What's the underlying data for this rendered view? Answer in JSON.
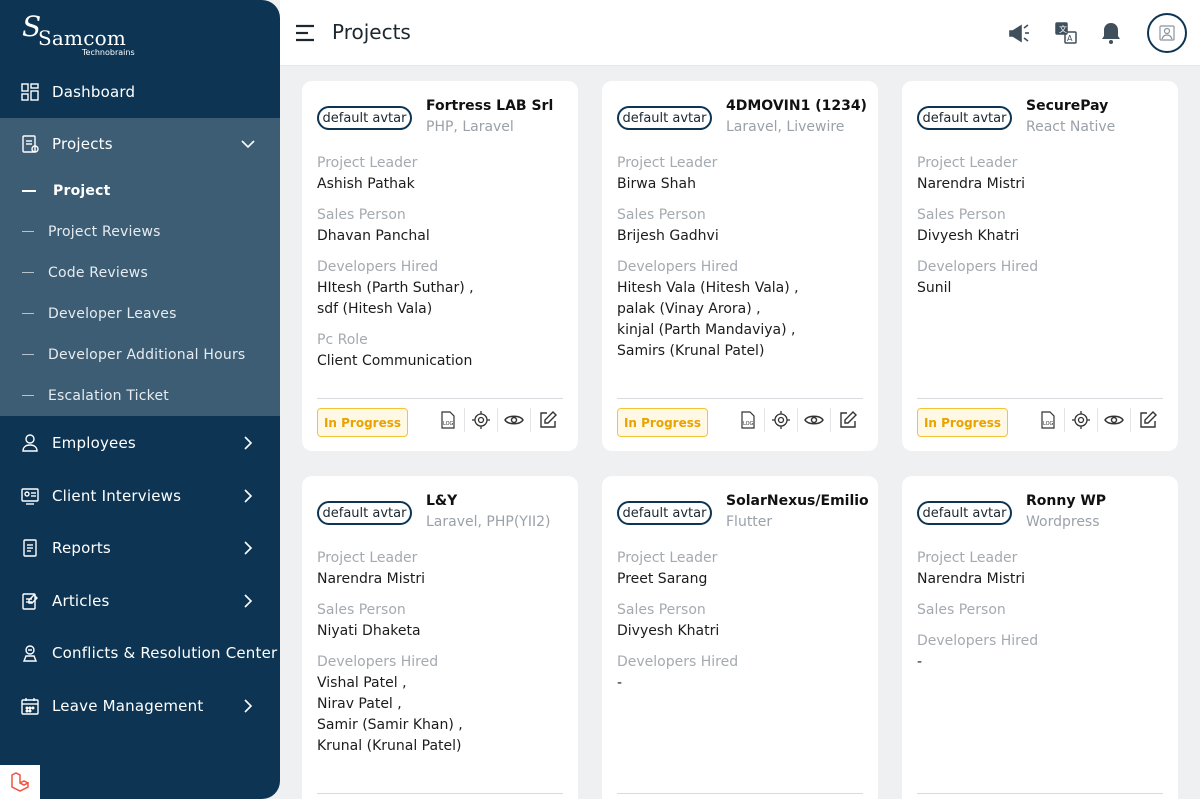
{
  "brand": {
    "name": "Samcom",
    "sub": "Technobrains",
    "mark": "S"
  },
  "header": {
    "title": "Projects"
  },
  "sidebar": {
    "items": [
      {
        "label": "Dashboard",
        "icon": "dashboard-icon"
      },
      {
        "label": "Projects",
        "icon": "projects-icon"
      },
      {
        "label": "Employees",
        "icon": "employees-icon"
      },
      {
        "label": "Client Interviews",
        "icon": "client-interviews-icon"
      },
      {
        "label": "Reports",
        "icon": "reports-icon"
      },
      {
        "label": "Articles",
        "icon": "articles-icon"
      },
      {
        "label": "Conflicts & Resolution Center",
        "icon": "conflicts-icon"
      },
      {
        "label": "Leave Management",
        "icon": "leave-icon"
      }
    ],
    "project_sub": [
      {
        "label": "Project"
      },
      {
        "label": "Project Reviews"
      },
      {
        "label": "Code Reviews"
      },
      {
        "label": "Developer Leaves"
      },
      {
        "label": "Developer Additional Hours"
      },
      {
        "label": "Escalation Ticket"
      }
    ]
  },
  "labels": {
    "leader": "Project Leader",
    "sales": "Sales Person",
    "devs": "Developers Hired",
    "pc_role": "Pc Role",
    "avatar_alt": "default avtar"
  },
  "cards": [
    {
      "name": "Fortress LAB Srl",
      "tech": "PHP, Laravel",
      "leader": "Ashish Pathak",
      "sales": "Dhavan Panchal",
      "devs": [
        "HItesh (Parth Suthar) ,",
        "sdf (Hitesh Vala)"
      ],
      "pc_role": "Client Communication",
      "status": "In Progress"
    },
    {
      "name": "4DMOVIN1 (1234)",
      "tech": "Laravel, Livewire",
      "leader": "Birwa Shah",
      "sales": "Brijesh Gadhvi",
      "devs": [
        "Hitesh Vala (Hitesh Vala) ,",
        "palak (Vinay Arora) ,",
        "kinjal (Parth Mandaviya) ,",
        "Samirs (Krunal Patel)"
      ],
      "status": "In Progress"
    },
    {
      "name": "SecurePay",
      "tech": "React Native",
      "leader": "Narendra Mistri",
      "sales": "Divyesh Khatri",
      "devs": [
        "Sunil"
      ],
      "status": "In Progress"
    },
    {
      "name": "L&Y",
      "tech": "Laravel, PHP(YII2)",
      "leader": "Narendra Mistri",
      "sales": "Niyati Dhaketa",
      "devs": [
        "Vishal Patel ,",
        "Nirav Patel ,",
        "Samir (Samir Khan) ,",
        "Krunal (Krunal Patel)"
      ]
    },
    {
      "name": "SolarNexus/Emilio",
      "tech": "Flutter",
      "leader": "Preet Sarang",
      "sales": "Divyesh Khatri",
      "devs": [
        "-"
      ]
    },
    {
      "name": "Ronny WP",
      "tech": "Wordpress",
      "leader": "Narendra Mistri",
      "sales": "",
      "devs": [
        "-"
      ]
    }
  ],
  "actions": [
    {
      "name": "log-icon"
    },
    {
      "name": "settings-target-icon"
    },
    {
      "name": "view-eye-icon"
    },
    {
      "name": "edit-icon"
    }
  ],
  "header_icons": [
    "announcement-icon",
    "translate-icon",
    "notification-bell-icon"
  ],
  "colors": {
    "sidebar": "#0d3553",
    "submenu": "#3d5d74",
    "status": "#e8a300"
  }
}
